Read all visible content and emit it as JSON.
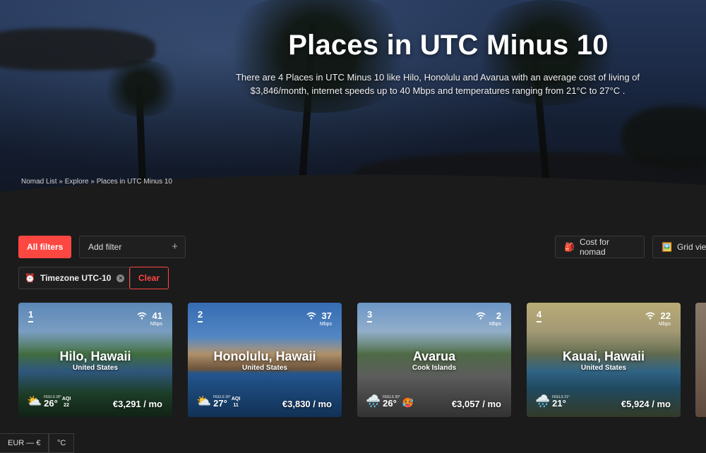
{
  "hero": {
    "title": "Places in UTC Minus 10",
    "description": "There are 4 Places in UTC Minus 10 like Hilo, Honolulu and Avarua with an average cost of living of $3,846/month, internet speeds up to 40 Mbps and temperatures ranging from 21°C to 27°C .",
    "breadcrumb": [
      "Nomad List",
      "Explore",
      "Places in UTC Minus 10"
    ],
    "breadcrumb_separator": "»"
  },
  "filters": {
    "all_filters_label": "All filters",
    "add_filter_label": "Add filter",
    "add_icon": "+",
    "active_chip_label": "Timezone UTC-10",
    "active_chip_icon": "⏰",
    "clear_label": "Clear",
    "cost_label": "Cost for nomad",
    "cost_icon": "🎒",
    "view_label": "Grid view",
    "view_icon": "🖼️"
  },
  "cards": [
    {
      "rank": "1",
      "internet": "41",
      "internet_unit": "Mbps",
      "name": "Hilo, Hawaii",
      "country": "United States",
      "weather_icon": "⛅",
      "feels": "FEELS 28°",
      "temp": "26°",
      "aqi_label": "AQI",
      "aqi_value": "22",
      "cost": "€3,291 / mo"
    },
    {
      "rank": "2",
      "internet": "37",
      "internet_unit": "Mbps",
      "name": "Honolulu, Hawaii",
      "country": "United States",
      "weather_icon": "⛅",
      "feels": "FEELS 30°",
      "temp": "27°",
      "aqi_label": "AQI",
      "aqi_value": "11",
      "cost": "€3,830 / mo"
    },
    {
      "rank": "3",
      "internet": "2",
      "internet_unit": "Mbps",
      "name": "Avarua",
      "country": "Cook Islands",
      "weather_icon": "🌧️",
      "feels": "FEELS 30°",
      "temp": "26°",
      "aqi_face": "🥵",
      "cost": "€3,057 / mo"
    },
    {
      "rank": "4",
      "internet": "22",
      "internet_unit": "Mbps",
      "name": "Kauai, Hawaii",
      "country": "United States",
      "weather_icon": "🌧️",
      "feels": "FEELS 21°",
      "temp": "21°",
      "cost": "€5,924 / mo"
    }
  ],
  "footer": {
    "currency_label": "EUR — €",
    "units_label": "°C"
  },
  "colors": {
    "accent": "#ff4742",
    "background": "#1b1b1b"
  }
}
